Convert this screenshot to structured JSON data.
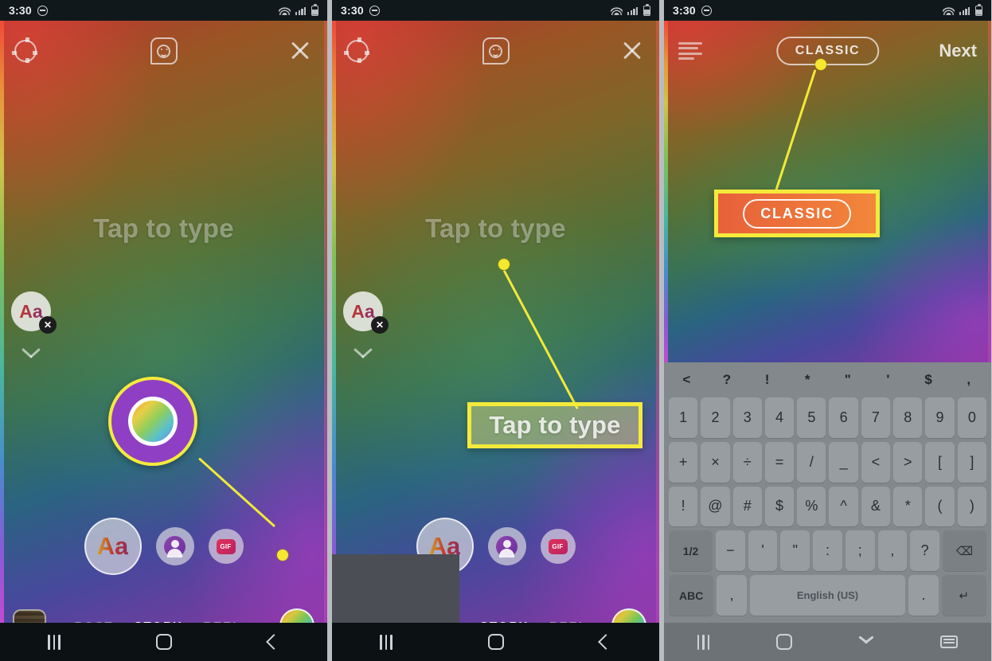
{
  "status_bar": {
    "time": "3:30",
    "icons": [
      "dnd-icon",
      "wifi-icon",
      "signal-icon",
      "battery-icon"
    ]
  },
  "panel1": {
    "top": {
      "settings_icon": "gear-icon",
      "sticker_icon": "sticker-face-icon",
      "close_icon": "close-icon"
    },
    "placeholder": "Tap to type",
    "aa_chip": {
      "label": "Aa",
      "delete": "✕"
    },
    "tools": {
      "text_label": "Aa",
      "avatar_icon": "avatar-icon",
      "gif_label": "GIF"
    },
    "modes": [
      {
        "label": "POST",
        "active": false
      },
      {
        "label": "STORY",
        "active": true
      },
      {
        "label": "REEL",
        "active": false
      }
    ],
    "gallery_icon": "gallery-thumbnail",
    "color_wheel_icon": "color-wheel-icon",
    "callout_note": "magnified color wheel highlight"
  },
  "panel2": {
    "top": {
      "settings_icon": "gear-icon",
      "sticker_icon": "sticker-face-icon",
      "close_icon": "close-icon"
    },
    "placeholder": "Tap to type",
    "aa_chip": {
      "label": "Aa",
      "delete": "✕"
    },
    "tools": {
      "text_label": "Aa",
      "avatar_icon": "avatar-icon",
      "gif_label": "GIF"
    },
    "modes": [
      {
        "label": "STORY",
        "active": true
      },
      {
        "label": "REEL",
        "active": false
      }
    ],
    "magnified_text": "Tap to type"
  },
  "panel3": {
    "top": {
      "menu_icon": "hamburger-icon",
      "style_label": "CLASSIC",
      "next_label": "Next"
    },
    "magnified_style": "CLASSIC",
    "keyboard": {
      "suggestions": [
        "<",
        "?",
        "!",
        "*",
        "\"",
        "'",
        "$",
        ","
      ],
      "row1": [
        "1",
        "2",
        "3",
        "4",
        "5",
        "6",
        "7",
        "8",
        "9",
        "0"
      ],
      "row2": [
        "+",
        "×",
        "÷",
        "=",
        "/",
        "_",
        "<",
        ">",
        "[",
        "]"
      ],
      "row3": [
        "!",
        "@",
        "#",
        "$",
        "%",
        "^",
        "&",
        "*",
        "(",
        ")"
      ],
      "row4": [
        "1/2",
        "−",
        "'",
        "\"",
        ":",
        ";",
        ",",
        "?",
        "⌫"
      ],
      "row5": [
        "ABC",
        ",",
        "English (US)",
        ".",
        "↵"
      ]
    }
  },
  "nav": {
    "recents_icon": "recents-icon",
    "home_icon": "home-icon",
    "back_icon": "back-icon",
    "hide_keyboard_icon": "chevron-down-icon",
    "keyboard_icon": "keyboard-icon"
  },
  "colors": {
    "highlight": "#f4ea3c",
    "accent_purple": "#8e3fc4",
    "classic_orange": "#e8603a"
  }
}
